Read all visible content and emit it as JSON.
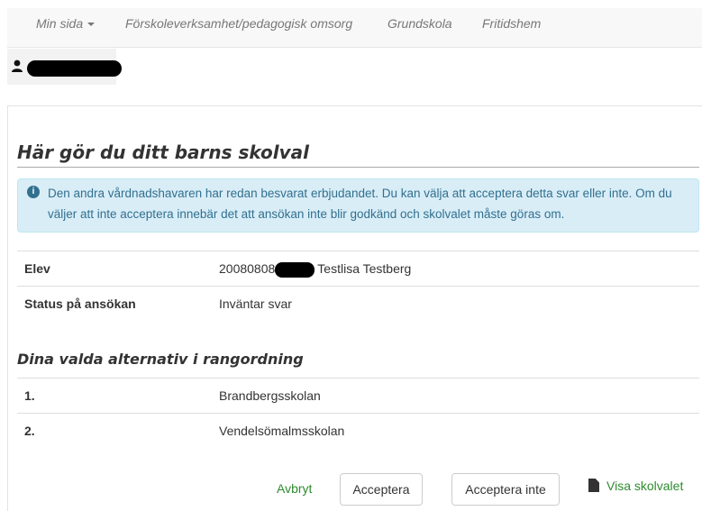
{
  "nav": {
    "items": [
      "Min sida",
      "Förskoleverksamhet/pedagogisk omsorg",
      "Grundskola",
      "Fritidshem"
    ]
  },
  "page": {
    "title": "Här gör du ditt barns skolval"
  },
  "alert": {
    "icon": "info-icon",
    "text": "Den andra vårdnadshavaren har redan besvarat erbjudandet. Du kan välja att acceptera detta svar eller inte. Om du väljer att inte acceptera innebär det att ansökan inte blir godkänd och skolvalet måste göras om."
  },
  "info": {
    "student_label": "Elev",
    "student_id_prefix": "20080808",
    "student_name": "Testlisa Testberg",
    "status_label": "Status på ansökan",
    "status_value": "Inväntar svar"
  },
  "choices": {
    "title": "Dina valda alternativ i rangordning",
    "items": [
      {
        "rank": "1.",
        "school": "Brandbergsskolan"
      },
      {
        "rank": "2.",
        "school": "Vendelsömalmsskolan"
      }
    ]
  },
  "actions": {
    "cancel": "Avbryt",
    "accept": "Acceptera",
    "decline": "Acceptera inte",
    "show": "Visa skolvalet"
  },
  "colors": {
    "alert_bg": "#d9edf7",
    "alert_text": "#31708f",
    "link_green": "#2e8b2e"
  }
}
